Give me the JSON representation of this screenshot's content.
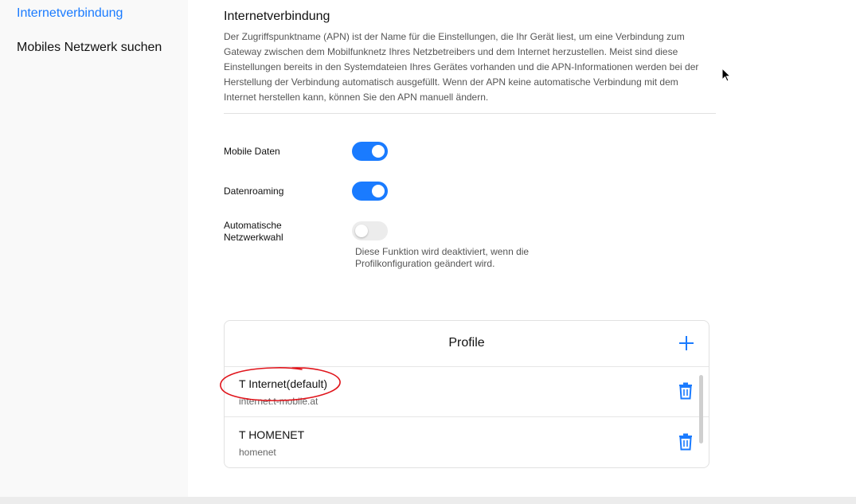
{
  "sidebar": {
    "items": [
      {
        "label": "Internetverbindung",
        "active": true
      },
      {
        "label": "Mobiles Netzwerk suchen",
        "active": false
      }
    ]
  },
  "section": {
    "title": "Internetverbindung",
    "description": "Der Zugriffspunktname (APN) ist der Name für die Einstellungen, die Ihr Gerät liest, um eine Verbindung zum Gateway zwischen dem Mobilfunknetz Ihres Netzbetreibers und dem Internet herzustellen. Meist sind diese Einstellungen bereits in den Systemdateien Ihres Gerätes vorhanden und die APN-Informationen werden bei der Herstellung der Verbindung automatisch ausgefüllt. Wenn der APN keine automatische Verbindung mit dem Internet herstellen kann, können Sie den APN manuell ändern."
  },
  "settings": {
    "mobile_data": {
      "label": "Mobile Daten",
      "enabled": true
    },
    "data_roaming": {
      "label": "Datenroaming",
      "enabled": true
    },
    "auto_network": {
      "label": "Automatische Netzwerkwahl",
      "enabled": false,
      "hint": "Diese Funktion wird deaktiviert, wenn die Profilkonfiguration geändert wird."
    }
  },
  "profiles": {
    "title": "Profile",
    "items": [
      {
        "name": "T Internet(default)",
        "apn": "internet.t-mobile.at"
      },
      {
        "name": "T HOMENET",
        "apn": "homenet"
      }
    ]
  },
  "icons": {
    "add": "plus-icon",
    "delete": "trash-icon",
    "cursor": "mouse-pointer-icon"
  },
  "colors": {
    "accent": "#1a7bff",
    "annotation": "#e0141b",
    "toggle_off": "#ececec"
  }
}
